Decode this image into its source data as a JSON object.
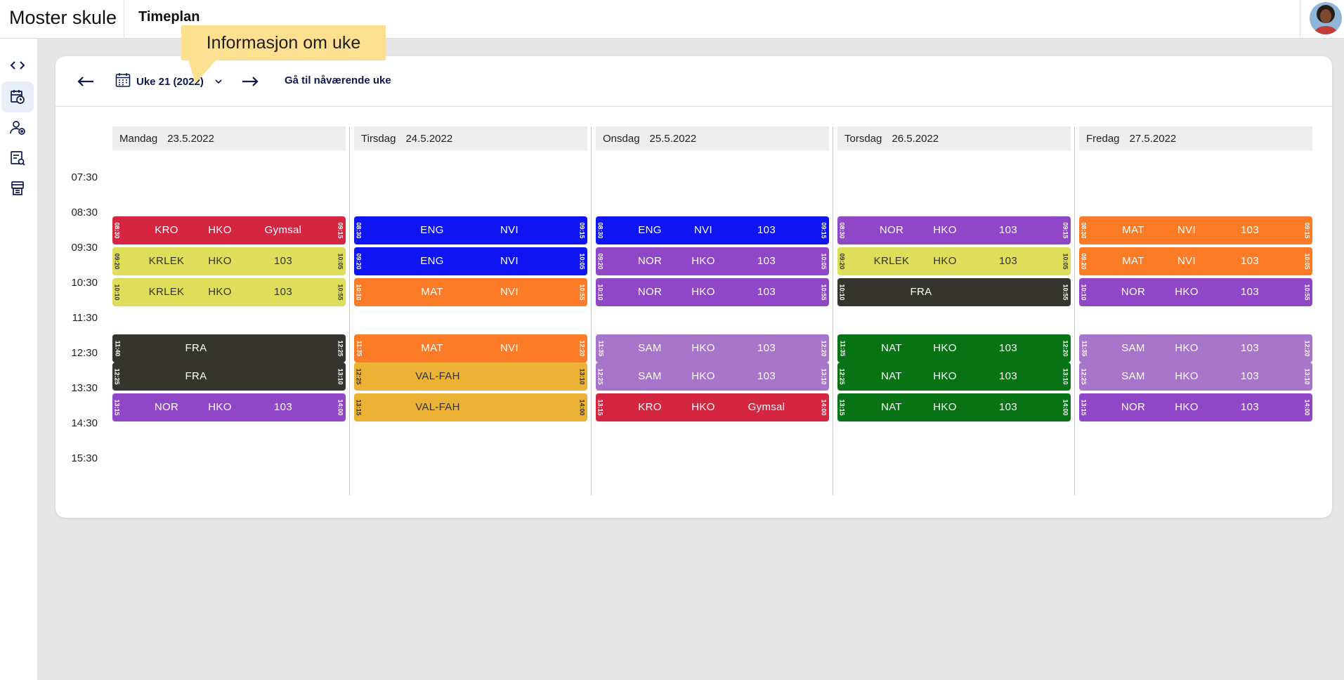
{
  "app": {
    "title": "Moster skule",
    "page_title": "Timeplan"
  },
  "tooltip": {
    "text": "Informasjon om uke"
  },
  "nav": {
    "week_label": "Uke 21 (2022)",
    "goto_current": "Gå til nåværende uke"
  },
  "sidebar": {
    "items": [
      {
        "icon": "code-brackets-icon"
      },
      {
        "icon": "timetable-clock-icon",
        "active": true
      },
      {
        "icon": "user-remove-icon"
      },
      {
        "icon": "document-search-icon"
      },
      {
        "icon": "printer-list-icon"
      }
    ]
  },
  "times": [
    "07:30",
    "08:30",
    "09:30",
    "10:30",
    "11:30",
    "12:30",
    "13:30",
    "14:30",
    "15:30"
  ],
  "days": [
    {
      "name": "Mandag",
      "date": "23.5.2022",
      "lessons": [
        {
          "start": "08:30",
          "end": "09:15",
          "color": "#d42640",
          "fields": [
            "KRO",
            "HKO",
            "Gymsal"
          ]
        },
        {
          "start": "09:20",
          "end": "10:05",
          "color": "#dede5a",
          "fields": [
            "KRLEK",
            "HKO",
            "103"
          ]
        },
        {
          "start": "10:10",
          "end": "10:55",
          "color": "#dede5a",
          "fields": [
            "KRLEK",
            "HKO",
            "103"
          ]
        },
        {
          "start": "11:40",
          "end": "12:25",
          "color": "#35352e",
          "fields": [
            "FRA"
          ]
        },
        {
          "start": "12:25",
          "end": "13:10",
          "color": "#35352e",
          "fields": [
            "FRA"
          ]
        },
        {
          "start": "13:15",
          "end": "14:00",
          "color": "#8f47c7",
          "fields": [
            "NOR",
            "HKO",
            "103"
          ]
        }
      ]
    },
    {
      "name": "Tirsdag",
      "date": "24.5.2022",
      "lessons": [
        {
          "start": "08:30",
          "end": "09:15",
          "color": "#0e14f2",
          "fields": [
            "ENG",
            "NVI"
          ]
        },
        {
          "start": "09:20",
          "end": "10:05",
          "color": "#0e14f2",
          "fields": [
            "ENG",
            "NVI"
          ]
        },
        {
          "start": "10:10",
          "end": "10:55",
          "color": "#fb7b27",
          "fields": [
            "MAT",
            "NVI"
          ]
        },
        {
          "start": "11:35",
          "end": "12:20",
          "color": "#fb7b27",
          "fields": [
            "MAT",
            "NVI"
          ]
        },
        {
          "start": "12:25",
          "end": "13:10",
          "color": "#ebb235",
          "fields": [
            "VAL-FAH"
          ]
        },
        {
          "start": "13:15",
          "end": "14:00",
          "color": "#ebb235",
          "fields": [
            "VAL-FAH"
          ]
        }
      ]
    },
    {
      "name": "Onsdag",
      "date": "25.5.2022",
      "lessons": [
        {
          "start": "08:30",
          "end": "09:15",
          "color": "#0e14f2",
          "fields": [
            "ENG",
            "NVI",
            "103"
          ]
        },
        {
          "start": "09:20",
          "end": "10:05",
          "color": "#8f47c7",
          "fields": [
            "NOR",
            "HKO",
            "103"
          ]
        },
        {
          "start": "10:10",
          "end": "10:55",
          "color": "#8f47c7",
          "fields": [
            "NOR",
            "HKO",
            "103"
          ]
        },
        {
          "start": "11:35",
          "end": "12:20",
          "color": "#a674c8",
          "fields": [
            "SAM",
            "HKO",
            "103"
          ]
        },
        {
          "start": "12:25",
          "end": "13:10",
          "color": "#a674c8",
          "fields": [
            "SAM",
            "HKO",
            "103"
          ]
        },
        {
          "start": "13:15",
          "end": "14:00",
          "color": "#d42640",
          "fields": [
            "KRO",
            "HKO",
            "Gymsal"
          ]
        }
      ]
    },
    {
      "name": "Torsdag",
      "date": "26.5.2022",
      "lessons": [
        {
          "start": "08:30",
          "end": "09:15",
          "color": "#8f47c7",
          "fields": [
            "NOR",
            "HKO",
            "103"
          ]
        },
        {
          "start": "09:20",
          "end": "10:05",
          "color": "#dede5a",
          "fields": [
            "KRLEK",
            "HKO",
            "103"
          ]
        },
        {
          "start": "10:10",
          "end": "10:55",
          "color": "#35352e",
          "fields": [
            "FRA"
          ]
        },
        {
          "start": "11:35",
          "end": "12:20",
          "color": "#087314",
          "fields": [
            "NAT",
            "HKO",
            "103"
          ]
        },
        {
          "start": "12:25",
          "end": "13:10",
          "color": "#087314",
          "fields": [
            "NAT",
            "HKO",
            "103"
          ]
        },
        {
          "start": "13:15",
          "end": "14:00",
          "color": "#087314",
          "fields": [
            "NAT",
            "HKO",
            "103"
          ]
        }
      ]
    },
    {
      "name": "Fredag",
      "date": "27.5.2022",
      "lessons": [
        {
          "start": "08:30",
          "end": "09:15",
          "color": "#fb7b27",
          "fields": [
            "MAT",
            "NVI",
            "103"
          ]
        },
        {
          "start": "09:20",
          "end": "10:05",
          "color": "#fb7b27",
          "fields": [
            "MAT",
            "NVI",
            "103"
          ]
        },
        {
          "start": "10:10",
          "end": "10:55",
          "color": "#8f47c7",
          "fields": [
            "NOR",
            "HKO",
            "103"
          ]
        },
        {
          "start": "11:35",
          "end": "12:20",
          "color": "#a674c8",
          "fields": [
            "SAM",
            "HKO",
            "103"
          ]
        },
        {
          "start": "12:25",
          "end": "13:10",
          "color": "#a674c8",
          "fields": [
            "SAM",
            "HKO",
            "103"
          ]
        },
        {
          "start": "13:15",
          "end": "14:00",
          "color": "#8f47c7",
          "fields": [
            "NOR",
            "HKO",
            "103"
          ]
        }
      ]
    }
  ]
}
